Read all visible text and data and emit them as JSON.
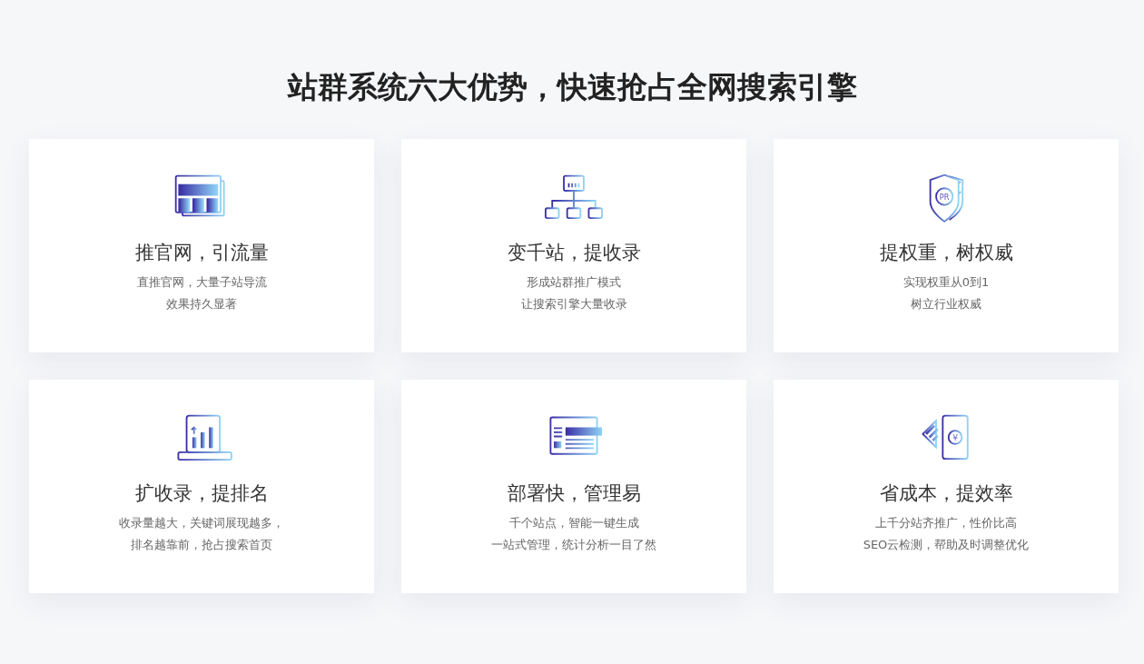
{
  "title": "站群系统六大优势，快速抢占全网搜索引擎",
  "cards": [
    {
      "kind": "browser",
      "heading": "推官网，引流量",
      "lines": [
        "直推官网，大量子站导流",
        "效果持久显著"
      ]
    },
    {
      "kind": "sitemap",
      "heading": "变千站，提收录",
      "lines": [
        "形成站群推广模式",
        "让搜索引擎大量收录"
      ]
    },
    {
      "kind": "shield",
      "icon_text": "PR",
      "heading": "提权重，树权威",
      "lines": [
        "实现权重从0到1",
        "树立行业权威"
      ]
    },
    {
      "kind": "chart",
      "heading": "扩收录，提排名",
      "lines": [
        "收录量越大，关键词展现越多，",
        "排名越靠前，抢占搜索首页"
      ]
    },
    {
      "kind": "webpage",
      "heading": "部署快，管理易",
      "lines": [
        "千个站点，智能一键生成",
        "一站式管理，统计分析一目了然"
      ]
    },
    {
      "kind": "money",
      "icon_text": "¥",
      "heading": "省成本，提效率",
      "lines": [
        "上千分站齐推广，性价比高",
        "SEO云检测，帮助及时调整优化"
      ]
    }
  ]
}
